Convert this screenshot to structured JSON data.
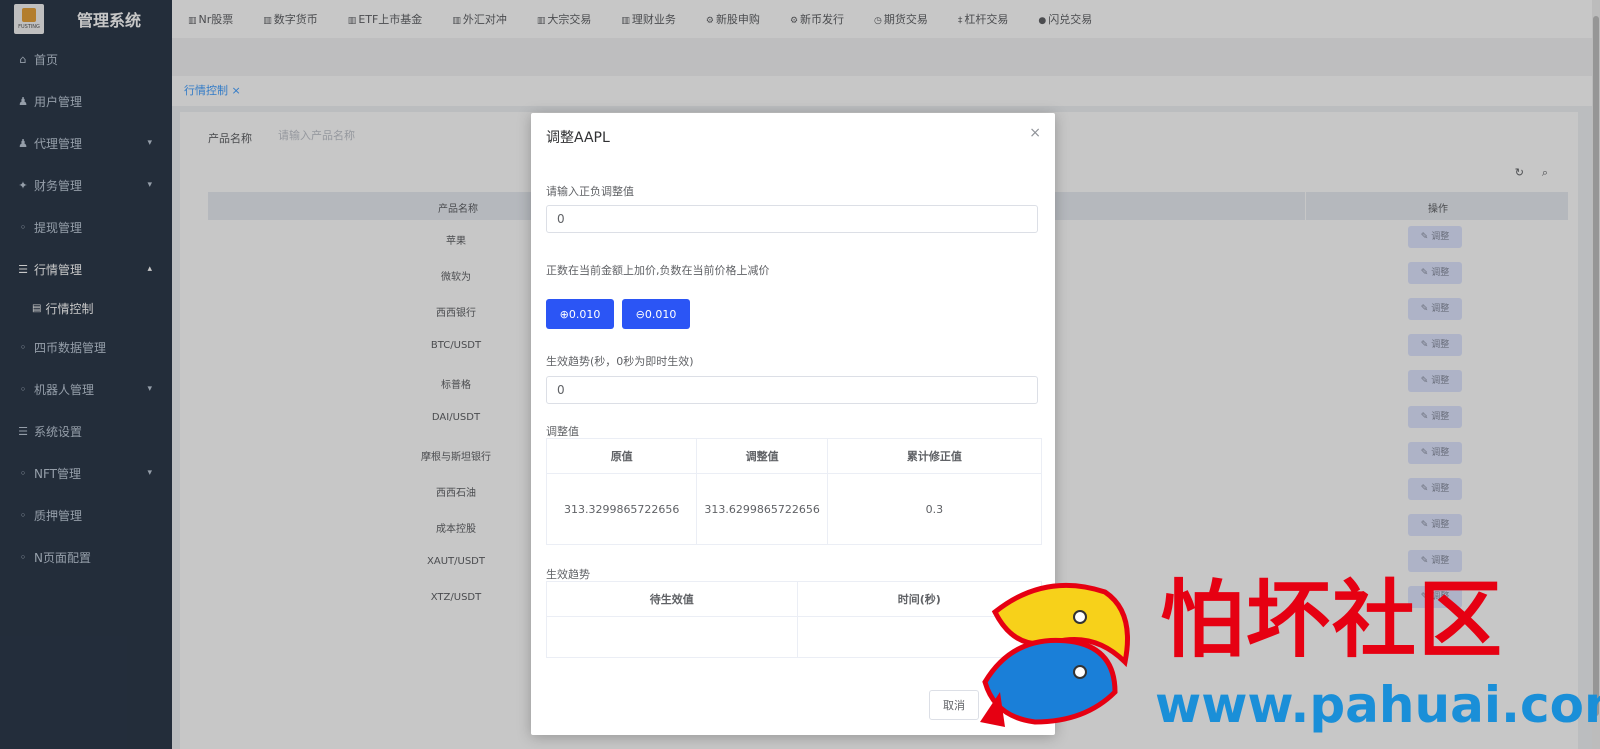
{
  "app": {
    "title": "管理系统",
    "logo_text": "FUSTING"
  },
  "sidebar": {
    "items": [
      {
        "label": "首页",
        "icon": "home-icon"
      },
      {
        "label": "用户管理",
        "icon": "user-icon"
      },
      {
        "label": "代理管理",
        "icon": "agent-icon"
      },
      {
        "label": "财务管理",
        "icon": "finance-icon"
      },
      {
        "label": "提现管理",
        "icon": "withdraw-icon"
      },
      {
        "label": "行情管理",
        "icon": "list-icon"
      },
      {
        "label": "行情控制",
        "icon": "grid-icon"
      },
      {
        "label": "四币数据管理",
        "icon": "data-icon"
      },
      {
        "label": "机器人管理",
        "icon": "robot-icon"
      },
      {
        "label": "系统设置",
        "icon": "settings-icon"
      },
      {
        "label": "NFT管理",
        "icon": "nft-icon"
      },
      {
        "label": "质押管理",
        "icon": "stake-icon"
      },
      {
        "label": "N页面配置",
        "icon": "page-icon"
      }
    ]
  },
  "topnav": {
    "items": [
      "Nr股票",
      "数字货币",
      "ETF上市基金",
      "外汇对冲",
      "大宗交易",
      "理财业务",
      "新股申购",
      "新币发行",
      "期货交易",
      "杠杆交易",
      "闪兑交易"
    ]
  },
  "tabs": [
    {
      "label": "行情控制",
      "close": "×"
    }
  ],
  "filter": {
    "label": "产品名称",
    "placeholder": "请输入产品名称"
  },
  "table": {
    "columns": [
      "产品名称",
      "操作"
    ],
    "rows": [
      "苹果",
      "微软为",
      "西西银行",
      "BTC/USDT",
      "标普格",
      "DAI/USDT",
      "摩根与斯坦银行",
      "西西石油",
      "成本控股",
      "XAUT/USDT",
      "XTZ/USDT"
    ],
    "row_action": "调整"
  },
  "dialog": {
    "title": "调整AAPL",
    "close_icon": "×",
    "adjust_label": "请输入正负调整值",
    "adjust_value": "0",
    "hint": "正数在当前金额上加价,负数在当前价格上减价",
    "plus_button": "⊕0.010",
    "minus_button": "⊖0.010",
    "trend_label": "生效趋势(秒，0秒为即时生效)",
    "trend_value": "0",
    "value_section_label": "调整值",
    "value_table": {
      "columns": [
        "原值",
        "调整值",
        "累计修正值"
      ],
      "rows": [
        [
          "313.3299865722656",
          "313.6299865722656",
          "0.3"
        ]
      ]
    },
    "trend_section_label": "生效趋势",
    "trend_table": {
      "columns": [
        "待生效值",
        "时间(秒)"
      ],
      "rows": []
    },
    "cancel_button": "取消"
  },
  "watermark": {
    "title": "怕坏社区",
    "url": "www.pahuai.com"
  },
  "colors": {
    "sidebar_bg": "#2d3a4b",
    "primary": "#2b55f5",
    "watermark_red": "#e60012",
    "watermark_blue": "#1a8fd8"
  }
}
